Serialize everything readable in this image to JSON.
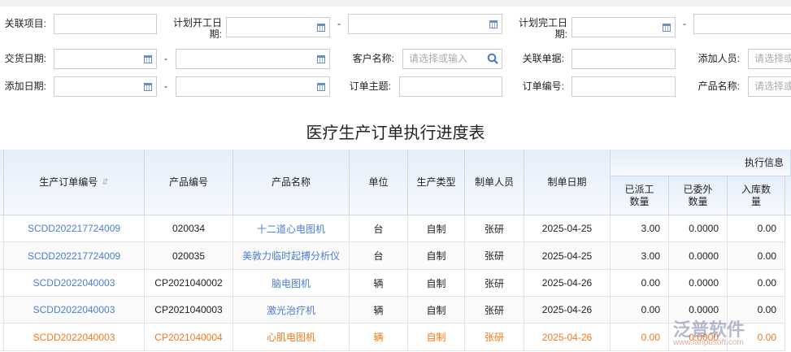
{
  "filters": {
    "related_project": "关联项目:",
    "plan_start": "计划开工日期:",
    "plan_end": "计划完工日期:",
    "delivery_date": "交货日期:",
    "customer": "客户名称:",
    "customer_placeholder": "请选择或输入",
    "related_doc": "关联单据:",
    "added_by": "添加人员:",
    "added_by_placeholder": "请选择或输入",
    "added_date": "添加日期:",
    "order_subject": "订单主题:",
    "order_no": "订单编号:",
    "product_name": "产品名称:",
    "product_name_placeholder": "请选择或输入",
    "dash": "-"
  },
  "title": "医疗生产订单执行进度表",
  "table": {
    "group_header": "执行信息",
    "headers": [
      "生产订单编号",
      "产品编号",
      "产品名称",
      "单位",
      "生产类型",
      "制单人员",
      "制单日期",
      "已派工数量",
      "已委外数量",
      "入库数量"
    ],
    "rows": [
      [
        "SCDD202217724009",
        "020034",
        "十二道心电图机",
        "台",
        "自制",
        "张研",
        "2025-04-25",
        "3.00",
        "0.0000",
        "0.00"
      ],
      [
        "SCDD202217724009",
        "020035",
        "美敦力临时起搏分析仪",
        "台",
        "自制",
        "张研",
        "2025-04-25",
        "3.00",
        "0.0000",
        "0.00"
      ],
      [
        "SCDD2022040003",
        "CP2021040002",
        "脑电图机",
        "辆",
        "自制",
        "张研",
        "2025-04-26",
        "0.00",
        "0.0000",
        "0.00"
      ],
      [
        "SCDD2022040003",
        "CP2021040003",
        "激光治疗机",
        "辆",
        "自制",
        "张研",
        "2025-04-26",
        "0.00",
        "0.0000",
        "0.00"
      ],
      [
        "SCDD2022040003",
        "CP2021040004",
        "心肌电图机",
        "辆",
        "自制",
        "张研",
        "2025-04-26",
        "0.00",
        "0.0000",
        "0.00"
      ]
    ],
    "highlighted_row": 4
  },
  "watermark": {
    "brand": "泛普软件",
    "url": "www.fanpusoft.com"
  },
  "colors": {
    "link": "#4a7fd0",
    "highlight": "#f07a1a",
    "header_bg": "#e6eef9"
  }
}
